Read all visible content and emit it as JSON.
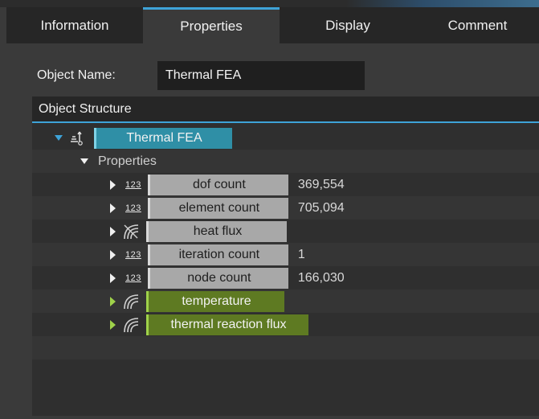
{
  "tabs": [
    {
      "label": "Information",
      "active": false
    },
    {
      "label": "Properties",
      "active": true
    },
    {
      "label": "Display",
      "active": false
    },
    {
      "label": "Comment",
      "active": false
    }
  ],
  "object_name": {
    "label": "Object Name:",
    "value": "Thermal FEA"
  },
  "structure": {
    "header": "Object Structure",
    "root": {
      "label": "Thermal FEA",
      "icon": "fea-model-icon"
    },
    "group": {
      "label": "Properties"
    },
    "items": [
      {
        "label": "dof count",
        "icon": "numeric-123-icon",
        "value": "369,554",
        "kind": "gray"
      },
      {
        "label": "element count",
        "icon": "numeric-123-icon",
        "value": "705,094",
        "kind": "gray"
      },
      {
        "label": "heat flux",
        "icon": "field-gray-icon",
        "value": "",
        "kind": "gray"
      },
      {
        "label": "iteration count",
        "icon": "numeric-123-icon",
        "value": "1",
        "kind": "gray"
      },
      {
        "label": "node count",
        "icon": "numeric-123-icon",
        "value": "166,030",
        "kind": "gray"
      },
      {
        "label": "temperature",
        "icon": "field-icon",
        "value": "",
        "kind": "green"
      },
      {
        "label": "thermal reaction flux",
        "icon": "field-icon",
        "value": "",
        "kind": "green"
      }
    ]
  },
  "colors": {
    "accent": "#3ea3d8",
    "green_chip": "#5e7a22",
    "gray_chip": "#a8a8a8",
    "blue_chip": "#2f8fa6"
  }
}
